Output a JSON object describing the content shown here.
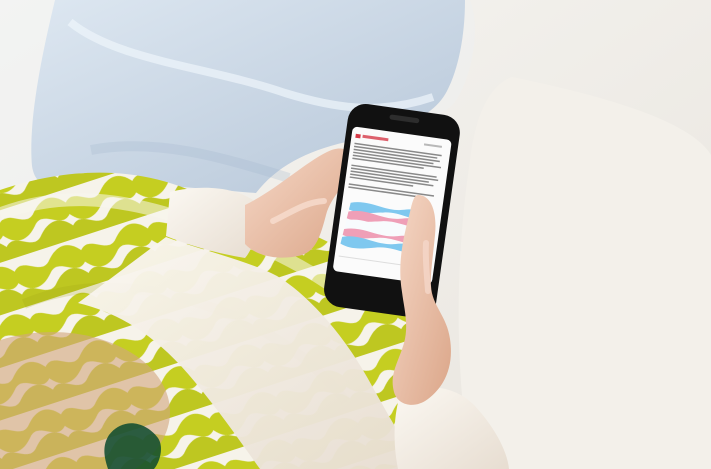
{
  "image": {
    "subject": "phone-reading-trans-flag-article",
    "scene_elements": [
      "jeans",
      "hands",
      "smartphone",
      "patterned-sleeve",
      "white-sweater",
      "cream-cushion"
    ],
    "colors": {
      "background": "#f2f0ec",
      "jeans": "#c9d5e2",
      "skin": "#efcdb8",
      "sweater": "#f7f2ea",
      "pattern_yellow": "#c7cf2b",
      "phone_frame": "#111111",
      "phone_screen": "#fbfbfb",
      "flag_blue": "#7fc8ef",
      "flag_pink": "#ef9fb7",
      "accent_red": "#d63a48"
    }
  }
}
